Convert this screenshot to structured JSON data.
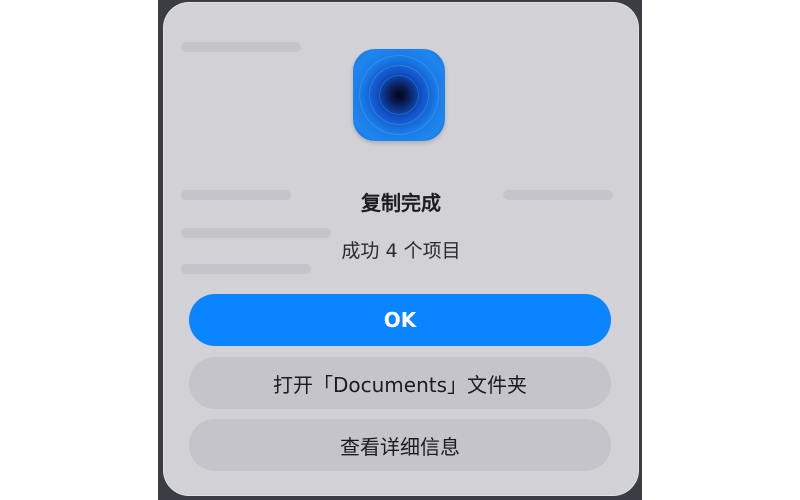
{
  "dialog": {
    "title": "复制完成",
    "message": "成功 4 个项目",
    "app_icon": "blue-vortex-app-icon"
  },
  "buttons": {
    "ok_label": "OK",
    "open_folder_label": "打开「Documents」文件夹",
    "details_label": "查看详细信息"
  },
  "colors": {
    "primary_button": "#0a84ff",
    "secondary_button": "#c4c4ca",
    "dialog_background": "#d1d1d6",
    "backdrop": "#3a3d44"
  }
}
